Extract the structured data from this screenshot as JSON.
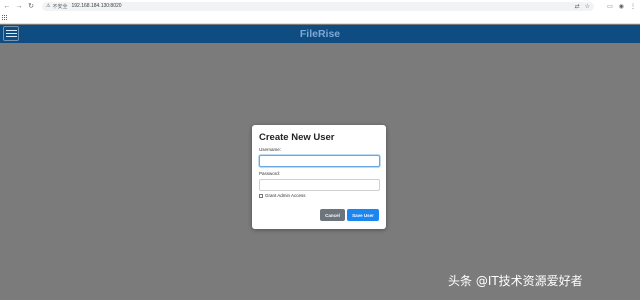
{
  "browser": {
    "security_label": "不安全",
    "url": "192.168.184.130:8020"
  },
  "app": {
    "title": "FileRise"
  },
  "modal": {
    "title": "Create New User",
    "username_label": "Username:",
    "username_value": "",
    "password_label": "Password:",
    "password_value": "",
    "admin_label": "Grant Admin Access",
    "admin_checked": false,
    "cancel_label": "Cancel",
    "save_label": "Save User"
  },
  "watermark": {
    "text": "头条 @IT技术资源爱好者"
  },
  "colors": {
    "header_bg": "#0f4c82",
    "overlay_bg": "#7b7b7b",
    "save_button": "#1a86f2",
    "cancel_button": "#6c757d"
  }
}
